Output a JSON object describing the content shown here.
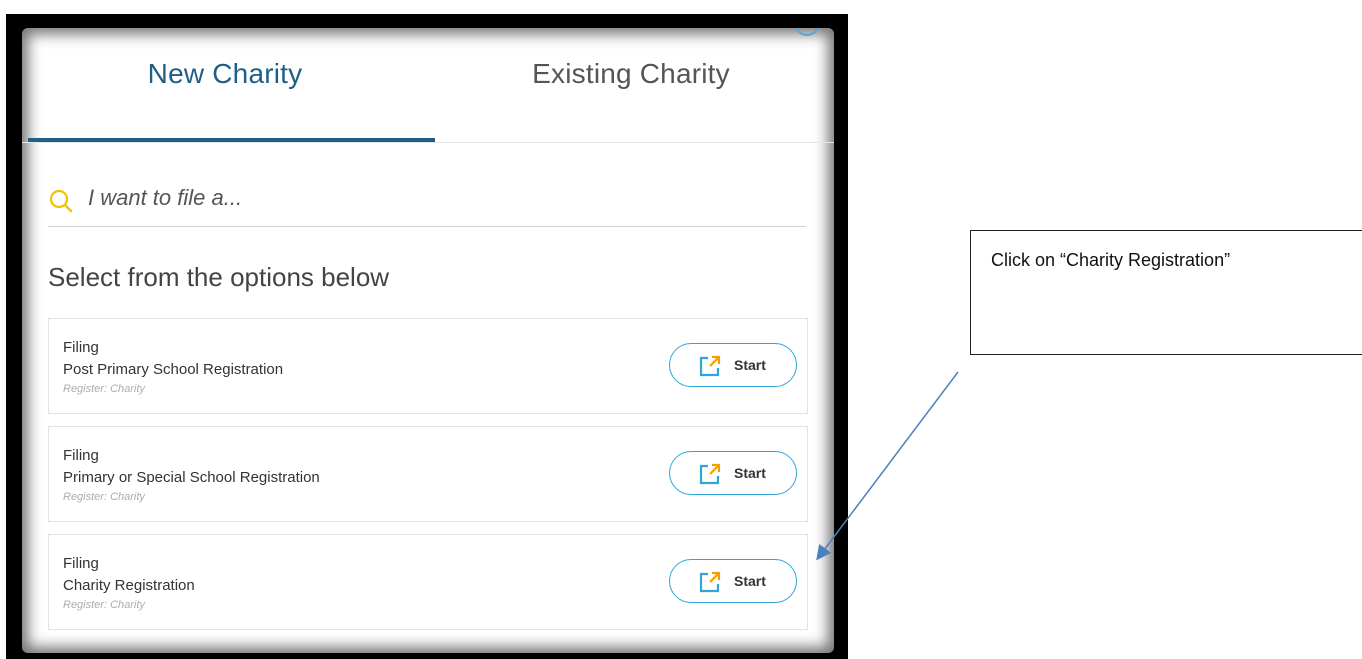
{
  "tabs": [
    {
      "label": "New Charity",
      "active": true
    },
    {
      "label": "Existing Charity",
      "active": false
    }
  ],
  "search": {
    "placeholder": "I want to file a..."
  },
  "section_title": "Select from the options below",
  "options": [
    {
      "kind": "Filing",
      "title": "Post Primary School Registration",
      "register": "Register: Charity",
      "button": "Start"
    },
    {
      "kind": "Filing",
      "title": "Primary or Special School Registration",
      "register": "Register: Charity",
      "button": "Start"
    },
    {
      "kind": "Filing",
      "title": "Charity Registration",
      "register": "Register: Charity",
      "button": "Start"
    }
  ],
  "callout": {
    "text": "Click on “Charity Registration”"
  },
  "colors": {
    "accent": "#1f5f86",
    "button_border": "#2fa6d8",
    "search_icon": "#f2c200",
    "start_icon": "#2fa6d8"
  },
  "icons": {
    "search": "search-icon",
    "start": "external-link-icon"
  }
}
